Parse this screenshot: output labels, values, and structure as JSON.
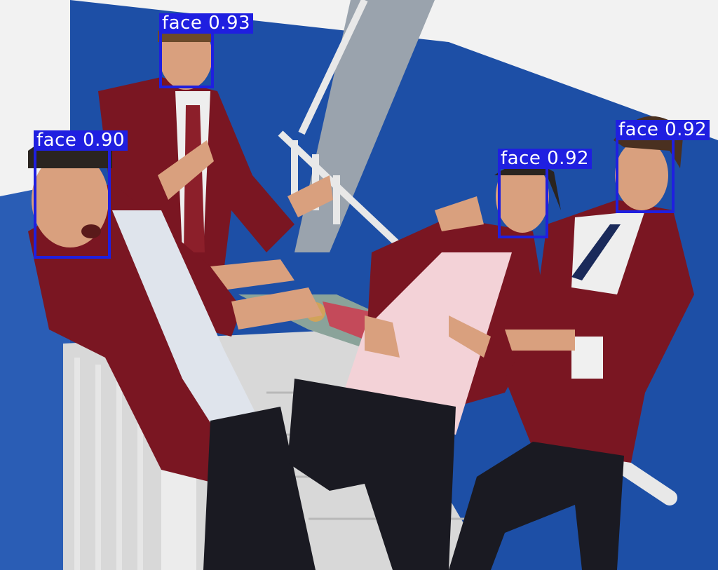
{
  "detections": [
    {
      "label": "face 0.93"
    },
    {
      "label": "face 0.90"
    },
    {
      "label": "face 0.92"
    },
    {
      "label": "face 0.92"
    }
  ],
  "colors": {
    "box": "#1f1fe0",
    "wall_blue": "#1d4fa6",
    "wall_white": "#f2f2f2",
    "blazer": "#7a1622",
    "trousers": "#1a1a22",
    "skin": "#d9a07e"
  }
}
